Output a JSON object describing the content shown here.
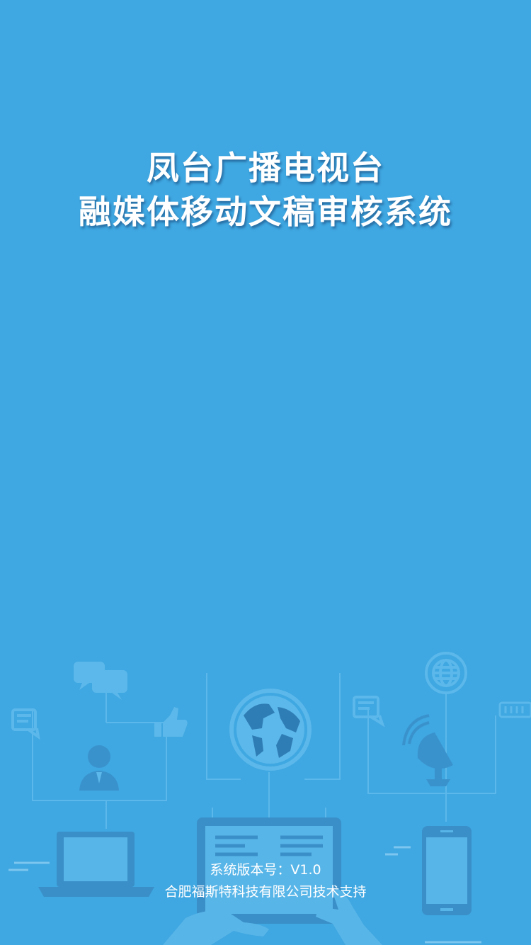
{
  "splash": {
    "title_line1": "凤台广播电视台",
    "title_line2": "融媒体移动文稿审核系统",
    "version_label": "系统版本号：",
    "version_value": "V1.0",
    "support_text": "合肥福斯特科技有限公司技术支持"
  },
  "colors": {
    "background": "#3fa7e1",
    "illustration": "#58b5e8",
    "illustration_dark": "#3a8fc8",
    "text": "#ffffff"
  },
  "icons": [
    "chat-bubbles-icon",
    "message-icon",
    "thumbs-up-icon",
    "user-icon",
    "globe-icon",
    "web-globe-icon",
    "satellite-dish-icon",
    "laptop-icon",
    "tablet-icon",
    "smartphone-icon",
    "hand-icon"
  ]
}
